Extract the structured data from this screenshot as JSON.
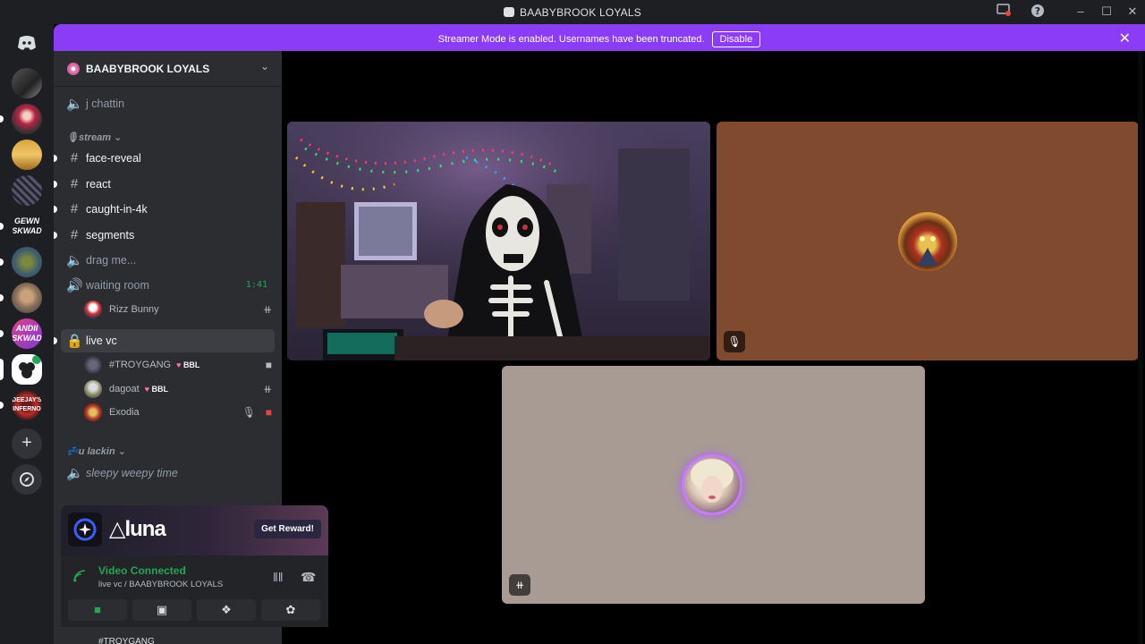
{
  "window": {
    "title": "BAABYBROOK LOYALS"
  },
  "banner": {
    "message": "Streamer Mode is enabled. Usernames have been truncated.",
    "button": "Disable"
  },
  "server": {
    "name": "BAABYBROOK LOYALS"
  },
  "channels": {
    "chattin": "j chattin",
    "category_stream": "stream",
    "face_reveal": "face-reveal",
    "react": "react",
    "caught": "caught-in-4k",
    "segments": "segments",
    "drag": "drag me...",
    "waiting": "waiting room",
    "waiting_timer": "1:41",
    "live": "live vc",
    "category_lackin": "u lackin",
    "sleepy": "sleepy weepy time"
  },
  "users": {
    "rizz": "Rizz Bunny",
    "troygang": "#TROYGANG",
    "dagoat": "dagoat",
    "exodia": "Exodia",
    "tag": "BBL"
  },
  "promo": {
    "brand": "luna",
    "button": "Get Reward!"
  },
  "voice": {
    "status": "Video Connected",
    "sub": "live vc / BAABYBROOK LOYALS"
  },
  "colors": {
    "accent": "#8b3cf7",
    "connected": "#23a55a",
    "tile_brown": "#7f4a2e",
    "tile_beige": "#a79b94"
  },
  "icons": [
    "discord-icon",
    "hash-icon",
    "speaker-icon",
    "lock-icon",
    "camera-icon",
    "screen-share-icon",
    "activity-icon",
    "soundboard-icon",
    "mic-off-icon",
    "hangup-icon",
    "signal-icon",
    "help-icon"
  ]
}
